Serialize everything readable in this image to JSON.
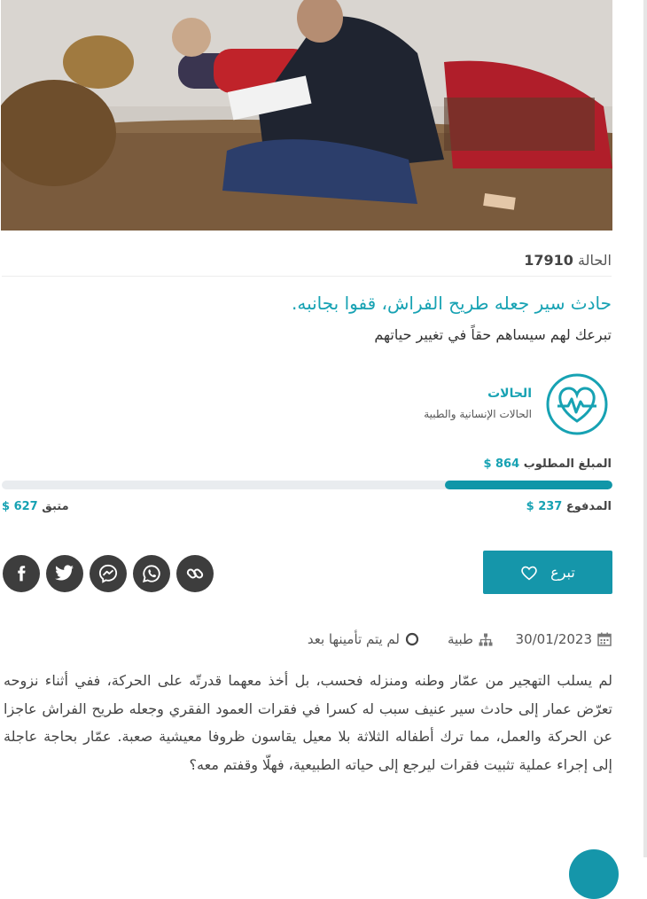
{
  "case": {
    "label": "الحالة",
    "number": "17910"
  },
  "title": "حادث سير جعله طريح الفراش، قفوا بجانبه.",
  "subtitle": "تبرعك لهم سيساهم حقاً في تغيير حياتهم",
  "category": {
    "title": "الحالات",
    "subtitle": "الحالات الإنسانية والطبية",
    "icon": "heart-pulse-icon"
  },
  "funding": {
    "required_label": "المبلغ المطلوب",
    "required": "864 $",
    "paid_label": "المدفوع",
    "paid": "237 $",
    "remaining_label": "متبق",
    "remaining": "627 $",
    "progress_fraction": 0.274
  },
  "donate": {
    "label": "تبرع",
    "icon": "heart-outline-icon"
  },
  "share": [
    {
      "name": "facebook-icon"
    },
    {
      "name": "twitter-icon"
    },
    {
      "name": "messenger-icon"
    },
    {
      "name": "whatsapp-icon"
    },
    {
      "name": "link-icon"
    }
  ],
  "meta": {
    "date": "30/01/2023",
    "type": "طبية",
    "status": "لم يتم تأمينها بعد"
  },
  "description": "لم يسلب التهجير من عمّار وطنه ومنزله فحسب، بل أخذ معهما قدرتّه على الحركة، ففي أثناء نزوحه تعرّض عمار إلى حادث سير عنيف سبب له كسرا في فقرات العمود الفقري وجعله طريح الفراش عاجزا عن الحركة والعمل، مما ترك أطفاله الثلاثة بلا معيل يقاسون ظروفا معيشية صعبة. عمّار بحاجة عاجلة إلى إجراء عملية تثبيت فقرات ليرجع إلى حياته الطبيعية، فهلّا وقفتم معه؟",
  "colors": {
    "accent": "#17a2b3",
    "button": "#1596aa",
    "share_bg": "#3d3d3d"
  }
}
